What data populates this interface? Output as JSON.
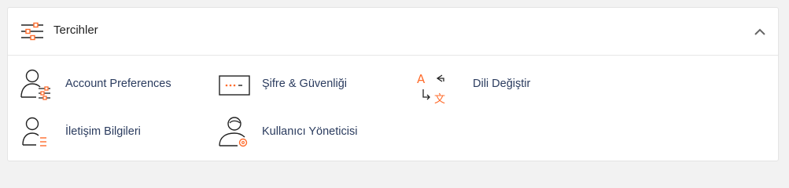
{
  "section": {
    "title": "Tercihler"
  },
  "items": [
    {
      "label": "Account Preferences",
      "icon": "user-settings-icon"
    },
    {
      "label": "Şifre & Güvenliği",
      "icon": "password-field-icon"
    },
    {
      "label": "Dili Değiştir",
      "icon": "translate-icon"
    },
    {
      "label": "İletişim Bilgileri",
      "icon": "contact-card-icon"
    },
    {
      "label": "Kullanıcı Yöneticisi",
      "icon": "user-manager-icon"
    }
  ],
  "colors": {
    "accent": "#ff6c2c",
    "icon_stroke": "#222222",
    "link_text": "#2a3b5e"
  }
}
